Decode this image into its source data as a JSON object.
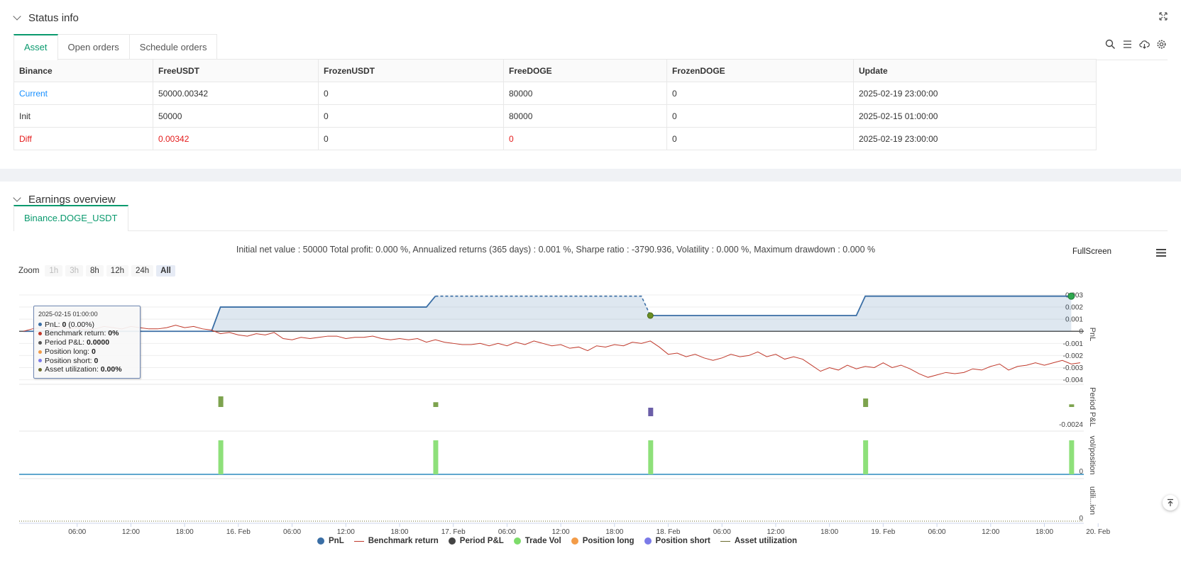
{
  "status": {
    "title": "Status info",
    "tabs": [
      "Asset",
      "Open orders",
      "Schedule orders"
    ],
    "table": {
      "headers": [
        "Binance",
        "FreeUSDT",
        "FrozenUSDT",
        "FreeDOGE",
        "FrozenDOGE",
        "Update"
      ],
      "rows": [
        [
          "Current",
          "50000.00342",
          "0",
          "80000",
          "0",
          "2025-02-19 23:00:00"
        ],
        [
          "Init",
          "50000",
          "0",
          "80000",
          "0",
          "2025-02-15 01:00:00"
        ],
        [
          "Diff",
          "0.00342",
          "0",
          "0",
          "0",
          "2025-02-19 23:00:00"
        ]
      ]
    }
  },
  "earnings": {
    "title": "Earnings overview",
    "tab": "Binance.DOGE_USDT",
    "summary": "Initial net value : 50000 Total profit: 0.000 %, Annualized returns (365 days) : 0.001 %, Sharpe ratio : -3790.936, Volatility : 0.000 %, Maximum drawdown : 0.000 %",
    "fullscreen": "FullScreen",
    "zoom": {
      "label": "Zoom",
      "buttons": [
        "1h",
        "3h",
        "8h",
        "12h",
        "24h",
        "All"
      ],
      "selected": "All"
    },
    "tooltip": {
      "timestamp": "2025-02-15 01:00:00",
      "rows": [
        {
          "label": "PnL: ",
          "value": "0",
          "extra": " (0.00%)",
          "color": "#3a6ea5"
        },
        {
          "label": "Benchmark return: ",
          "value": "0%",
          "extra": "",
          "color": "#c0392b"
        },
        {
          "label": "Period P&L: ",
          "value": "0.0000",
          "extra": "",
          "color": "#555555"
        },
        {
          "label": "Position long: ",
          "value": "0",
          "extra": "",
          "color": "#f39c48"
        },
        {
          "label": "Position short: ",
          "value": "0",
          "extra": "",
          "color": "#7b7ae8"
        },
        {
          "label": "Asset utilization: ",
          "value": "0.00%",
          "extra": "",
          "color": "#6b6b2f"
        }
      ]
    },
    "legend": [
      {
        "label": "PnL",
        "color": "#3a6ea5",
        "shape": "dot"
      },
      {
        "label": "Benchmark return",
        "color": "#c0392b",
        "shape": "line"
      },
      {
        "label": "Period P&L",
        "color": "#444444",
        "shape": "dot"
      },
      {
        "label": "Trade Vol",
        "color": "#7ddc6a",
        "shape": "dot"
      },
      {
        "label": "Position long",
        "color": "#f39c48",
        "shape": "dot"
      },
      {
        "label": "Position short",
        "color": "#7b7ae8",
        "shape": "dot"
      },
      {
        "label": "Asset utilization",
        "color": "#6b6b2f",
        "shape": "line"
      }
    ]
  },
  "chart_data": {
    "type": "line",
    "x_ticks": [
      "06:00",
      "12:00",
      "18:00",
      "16. Feb",
      "06:00",
      "12:00",
      "18:00",
      "17. Feb",
      "06:00",
      "12:00",
      "18:00",
      "18. Feb",
      "06:00",
      "12:00",
      "18:00",
      "19. Feb",
      "06:00",
      "12:00",
      "18:00",
      "20. Feb"
    ],
    "x_range_hours": [
      0,
      118
    ],
    "panels": [
      {
        "name": "PnL",
        "ylabel": "PnL",
        "y_ticks": [
          "0.003",
          "0.002",
          "0.001",
          "0",
          "-0.001",
          "-0.002",
          "-0.003",
          "-0.004"
        ],
        "ylim": [
          -0.0042,
          0.0037
        ],
        "series": [
          {
            "name": "PnL",
            "color": "#3a6ea5",
            "points": [
              [
                0,
                0
              ],
              [
                21,
                0
              ],
              [
                22,
                0.002
              ],
              [
                45,
                0.002
              ],
              [
                46,
                0.0029
              ],
              [
                69,
                0.0029
              ],
              [
                70,
                0.0013
              ],
              [
                93,
                0.0013
              ],
              [
                94,
                0.0029
              ],
              [
                117,
                0.0029
              ]
            ]
          },
          {
            "name": "Benchmark return",
            "color": "#c0392b",
            "points": [
              [
                0,
                0
              ],
              [
                1,
                0.0002
              ],
              [
                2,
                0.0003
              ],
              [
                3,
                0.0001
              ],
              [
                4,
                0.0004
              ],
              [
                5,
                0.0002
              ],
              [
                6,
                0.0003
              ],
              [
                7,
                0.0001
              ],
              [
                8,
                0.0002
              ],
              [
                9,
                0.0004
              ],
              [
                10,
                0.0003
              ],
              [
                11,
                0.0002
              ],
              [
                12,
                0.0004
              ],
              [
                13,
                0.0003
              ],
              [
                14,
                0.0002
              ],
              [
                15,
                0.0002
              ],
              [
                16,
                0.0003
              ],
              [
                17,
                0.0005
              ],
              [
                18,
                0.0003
              ],
              [
                19,
                0.0004
              ],
              [
                20,
                0.0002
              ],
              [
                21,
                0.0001
              ],
              [
                22,
                -0.0002
              ],
              [
                23,
                -0.0001
              ],
              [
                24,
                -0.0003
              ],
              [
                25,
                -0.0004
              ],
              [
                26,
                -0.0002
              ],
              [
                27,
                -0.0003
              ],
              [
                28,
                -0.0001
              ],
              [
                29,
                -0.0006
              ],
              [
                30,
                -0.0007
              ],
              [
                31,
                -0.0005
              ],
              [
                32,
                -0.0006
              ],
              [
                33,
                -0.0005
              ],
              [
                34,
                -0.0004
              ],
              [
                35,
                -0.0004
              ],
              [
                36,
                -0.0006
              ],
              [
                37,
                -0.0005
              ],
              [
                38,
                -0.0005
              ],
              [
                39,
                -0.0004
              ],
              [
                40,
                -0.0006
              ],
              [
                41,
                -0.0007
              ],
              [
                42,
                -0.0006
              ],
              [
                43,
                -0.0007
              ],
              [
                44,
                -0.0006
              ],
              [
                45,
                -0.0009
              ],
              [
                46,
                -0.0007
              ],
              [
                47,
                -0.0009
              ],
              [
                48,
                -0.001
              ],
              [
                49,
                -0.0011
              ],
              [
                50,
                -0.0011
              ],
              [
                51,
                -0.001
              ],
              [
                52,
                -0.0012
              ],
              [
                53,
                -0.001
              ],
              [
                54,
                -0.0012
              ],
              [
                55,
                -0.0009
              ],
              [
                56,
                -0.0011
              ],
              [
                57,
                -0.0008
              ],
              [
                58,
                -0.001
              ],
              [
                59,
                -0.0012
              ],
              [
                60,
                -0.0011
              ],
              [
                61,
                -0.0014
              ],
              [
                62,
                -0.0013
              ],
              [
                63,
                -0.0016
              ],
              [
                64,
                -0.0012
              ],
              [
                65,
                -0.0013
              ],
              [
                66,
                -0.0011
              ],
              [
                67,
                -0.0012
              ],
              [
                68,
                -0.0009
              ],
              [
                69,
                -0.001
              ],
              [
                70,
                -0.0008
              ],
              [
                71,
                -0.0013
              ],
              [
                72,
                -0.0019
              ],
              [
                73,
                -0.0018
              ],
              [
                74,
                -0.0021
              ],
              [
                75,
                -0.0019
              ],
              [
                76,
                -0.0022
              ],
              [
                77,
                -0.0024
              ],
              [
                78,
                -0.0022
              ],
              [
                79,
                -0.0019
              ],
              [
                80,
                -0.0021
              ],
              [
                81,
                -0.002
              ],
              [
                82,
                -0.0017
              ],
              [
                83,
                -0.0021
              ],
              [
                84,
                -0.0019
              ],
              [
                85,
                -0.0023
              ],
              [
                86,
                -0.0021
              ],
              [
                87,
                -0.0023
              ],
              [
                88,
                -0.0028
              ],
              [
                89,
                -0.0033
              ],
              [
                90,
                -0.003
              ],
              [
                91,
                -0.0032
              ],
              [
                92,
                -0.0028
              ],
              [
                93,
                -0.0031
              ],
              [
                94,
                -0.0029
              ],
              [
                95,
                -0.003
              ],
              [
                96,
                -0.0026
              ],
              [
                97,
                -0.003
              ],
              [
                98,
                -0.0028
              ],
              [
                99,
                -0.0031
              ],
              [
                100,
                -0.0035
              ],
              [
                101,
                -0.0038
              ],
              [
                102,
                -0.0036
              ],
              [
                103,
                -0.0034
              ],
              [
                104,
                -0.0035
              ],
              [
                105,
                -0.0034
              ],
              [
                106,
                -0.0031
              ],
              [
                107,
                -0.0032
              ],
              [
                108,
                -0.0029
              ],
              [
                109,
                -0.0027
              ],
              [
                110,
                -0.0032
              ],
              [
                111,
                -0.0029
              ],
              [
                112,
                -0.0028
              ],
              [
                113,
                -0.0026
              ],
              [
                114,
                -0.0028
              ],
              [
                115,
                -0.0026
              ],
              [
                116,
                -0.0024
              ],
              [
                117,
                -0.0027
              ],
              [
                118,
                -0.0026
              ]
            ]
          }
        ]
      },
      {
        "name": "Period P&L",
        "ylabel": "Period P&L",
        "y_ticks": [
          "-0.0024"
        ],
        "bars": [
          {
            "x": 22,
            "value": 0.002,
            "color": "#7da34e"
          },
          {
            "x": 46,
            "value": 0.0009,
            "color": "#7da34e"
          },
          {
            "x": 70,
            "value": -0.0016,
            "color": "#6b5ea8"
          },
          {
            "x": 94,
            "value": 0.0016,
            "color": "#7da34e"
          },
          {
            "x": 117,
            "value": 0.0005,
            "color": "#7da34e"
          }
        ]
      },
      {
        "name": "Trade Vol",
        "ylabel": "vol/position",
        "y_ticks": [
          "0"
        ],
        "bars": [
          {
            "x": 22,
            "value": 1,
            "color": "#8ee07a"
          },
          {
            "x": 46,
            "value": 1,
            "color": "#8ee07a"
          },
          {
            "x": 70,
            "value": 1,
            "color": "#8ee07a"
          },
          {
            "x": 94,
            "value": 1,
            "color": "#8ee07a"
          },
          {
            "x": 117,
            "value": 1,
            "color": "#8ee07a"
          }
        ]
      },
      {
        "name": "Asset utilization",
        "ylabel": "utili...ion",
        "y_ticks": [
          "0"
        ]
      }
    ]
  }
}
